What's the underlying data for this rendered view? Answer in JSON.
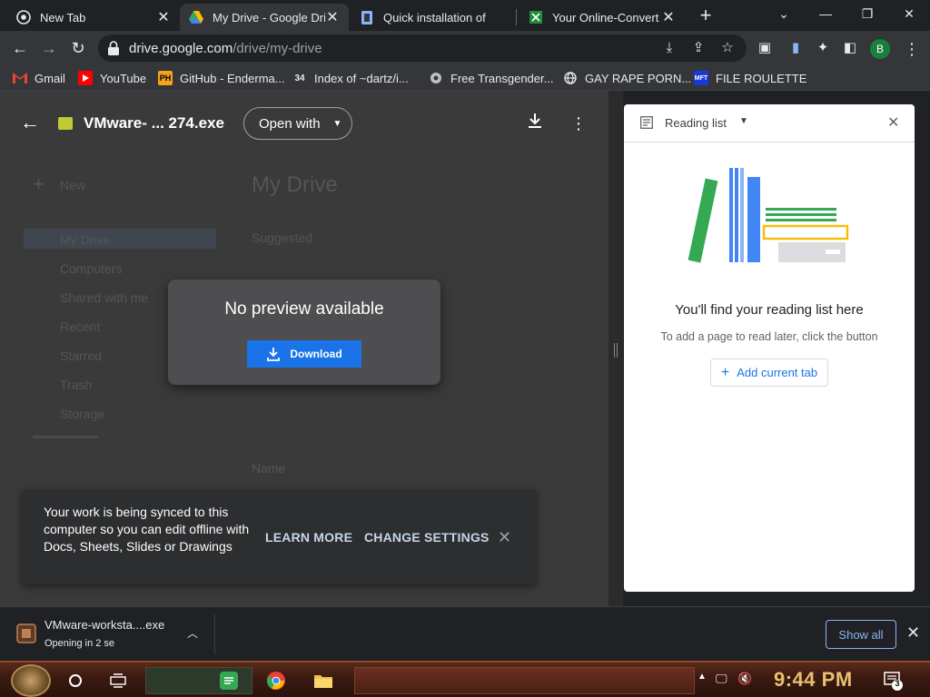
{
  "tabs": [
    {
      "title": "New Tab",
      "favicon": "chrome-icon"
    },
    {
      "title": "My Drive - Google Dri",
      "favicon": "drive-icon",
      "active": true
    },
    {
      "title": "Quick installation of",
      "favicon": "doc-icon"
    },
    {
      "title": "Your Online-Convert",
      "favicon": "convert-icon"
    }
  ],
  "address_bar": {
    "host": "drive.google.com",
    "path": "/drive/my-drive"
  },
  "bookmarks": [
    {
      "label": "Gmail"
    },
    {
      "label": "YouTube"
    },
    {
      "label": "GitHub - Enderma..."
    },
    {
      "label": "Index of ~dartz/i..."
    },
    {
      "label": "Free Transgender..."
    },
    {
      "label": "GAY RAPE PORN..."
    },
    {
      "label": "FILE ROULETTE"
    }
  ],
  "bookmark_badges": {
    "index": "34",
    "github": "PH",
    "roulette": "MFT"
  },
  "profile_initial": "B",
  "viewer": {
    "file_name": "VMware- ... 274.exe",
    "open_with": "Open with",
    "no_preview": "No preview available",
    "download_label": "Download"
  },
  "background": {
    "new": "New",
    "my_drive_title": "My Drive",
    "suggested": "Suggested",
    "nav": [
      "My Drive",
      "Computers",
      "Shared with me",
      "Recent",
      "Starred",
      "Trash",
      "Storage"
    ],
    "name_col": "Name"
  },
  "sync_banner": {
    "text": "Your work is being synced to this computer so you can edit offline with Docs, Sheets, Slides or Drawings",
    "learn_more": "LEARN MORE",
    "change_settings": "CHANGE SETTINGS"
  },
  "reading_list": {
    "title": "Reading list",
    "empty_title": "You'll find your reading list here",
    "empty_sub": "To add a page to read later, click the button",
    "add_button": "Add current tab"
  },
  "download_shelf": {
    "file": "VMware-worksta....exe",
    "status": "Opening in 2 se",
    "show_all": "Show all"
  },
  "taskbar": {
    "clock": "9:44 PM",
    "notif_count": "3"
  },
  "colors": {
    "accent": "#1a73e8",
    "link": "#8ab4f8",
    "clock": "#e8c070"
  }
}
